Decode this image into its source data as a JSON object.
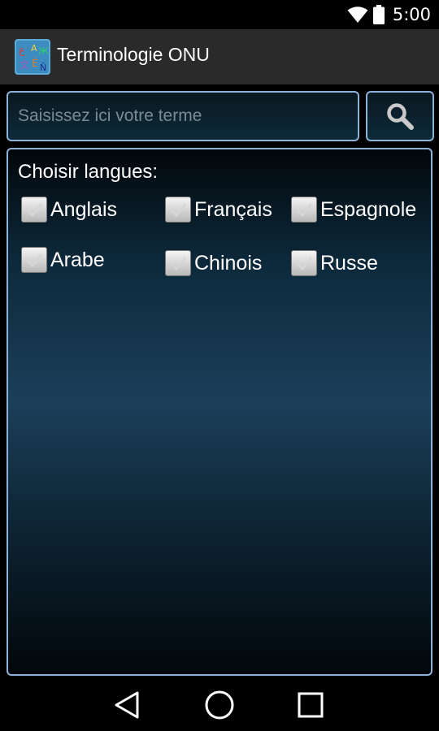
{
  "status_bar": {
    "time": "5:00"
  },
  "app": {
    "title": "Terminologie ONU"
  },
  "search": {
    "placeholder": "Saisissez ici votre terme",
    "value": ""
  },
  "languages": {
    "heading": "Choisir langues:",
    "options": [
      {
        "label": "Anglais",
        "checked": true
      },
      {
        "label": "Français",
        "checked": true
      },
      {
        "label": "Espagnole",
        "checked": true
      },
      {
        "label": "Arabe",
        "checked": true
      },
      {
        "label": "Chinois",
        "checked": true
      },
      {
        "label": "Russe",
        "checked": true
      }
    ]
  },
  "colors": {
    "accent_border": "#8fb2d8",
    "action_bar": "#2a2a2a",
    "panel_mid": "#1b3f5a"
  },
  "icons": {
    "wifi": "wifi-icon",
    "battery": "battery-icon",
    "search": "search-icon",
    "back": "back-icon",
    "home": "home-icon",
    "recents": "recents-icon"
  }
}
